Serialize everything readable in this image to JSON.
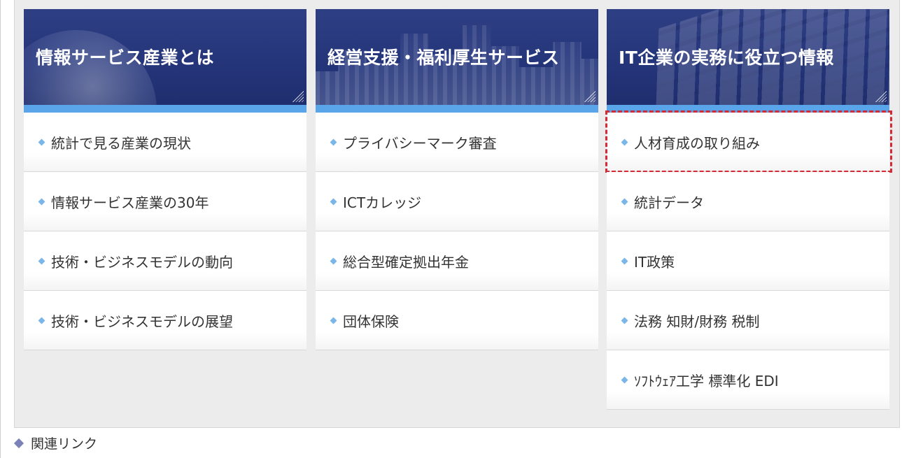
{
  "columns": [
    {
      "title": "情報サービス産業とは",
      "items": [
        {
          "label": "統計で見る産業の現状"
        },
        {
          "label": "情報サービス産業の30年"
        },
        {
          "label": "技術・ビジネスモデルの動向"
        },
        {
          "label": "技術・ビジネスモデルの展望"
        }
      ]
    },
    {
      "title": "経営支援・福利厚生サービス",
      "items": [
        {
          "label": "プライバシーマーク審査"
        },
        {
          "label": "ICTカレッジ"
        },
        {
          "label": "総合型確定拠出年金"
        },
        {
          "label": "団体保険"
        }
      ]
    },
    {
      "title": "IT企業の実務に役立つ情報",
      "items": [
        {
          "label": "人材育成の取り組み"
        },
        {
          "label": "統計データ"
        },
        {
          "label": "IT政策"
        },
        {
          "label": "法務 知財/財務 税制"
        },
        {
          "label": "ｿﾌﾄｳｪｱ工学 標準化 EDI"
        }
      ]
    }
  ],
  "related_links": {
    "label": "関連リンク"
  },
  "colors": {
    "header_bg": "#25357a",
    "accent_bar": "#5aa4ea",
    "bullet": "#7ab6e8",
    "highlight_border": "#d42a35",
    "panel_bg": "#ececec"
  },
  "icons": {
    "item_bullet": "diamond-bullet-icon",
    "header_corner": "resize-corner-icon",
    "related_marker": "diamond-icon"
  }
}
